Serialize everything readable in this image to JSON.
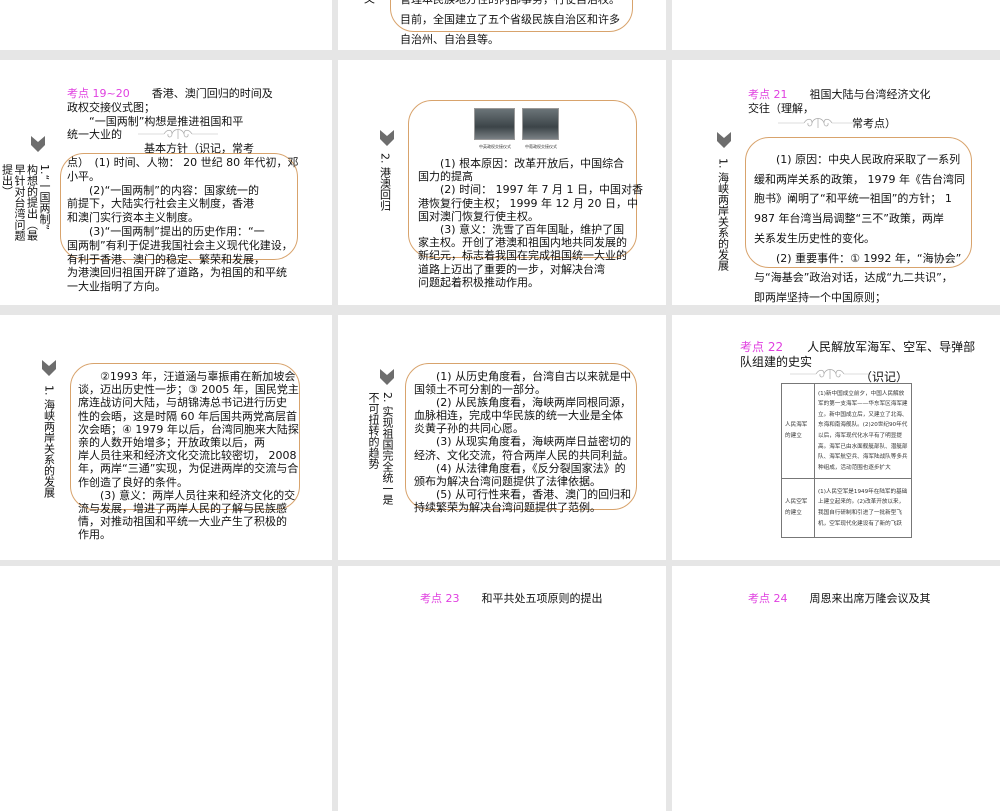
{
  "slides": [
    {
      "vertical": [
        "义"
      ],
      "body": [
        "管理本民族地方性的内部事务，行使自治权。",
        "目前，全国建立了五个省级民族自治区和许多",
        "自治州、自治县等。"
      ]
    },
    {
      "vertical": [
        "1.“一国两制”",
        "构想的提出（最",
        "早针对台湾问题",
        "提出）"
      ],
      "body": [
        {
          "tag": "考点 19~20",
          "text": "　　香港、澳门回归的时间及"
        },
        "政权交接仪式图；",
        "　　“一国两制”构想是推进祖国和平",
        "统一大业的",
        "　　　　　　　基本方针（识记，常考",
        "点）　(1) 时间、人物： 20 世纪 80 年代初，邓",
        "小平。",
        "　　(2)“一国两制”的内容：国家统一的",
        "前提下，大陆实行社会主义制度，香港",
        "和澳门实行资本主义制度。",
        "　　(3)“一国两制”提出的历史作用：“一",
        "国两制”有利于促进我国社会主义现代化建设，",
        "有利于香港、澳门的稳定、繁荣和发展，",
        "为港澳回归祖国开辟了道路，为祖国的和平统",
        "一大业指明了方向。"
      ]
    },
    {
      "vertical": [
        "2. 港澳回归"
      ],
      "captions": [
        "中英政权交接仪式",
        "中葡政权交接仪式"
      ],
      "body": [
        "　　(1) 根本原因：改革开放后，中国综合",
        "国力的提高",
        "　　(2) 时间： 1997 年 7 月 1 日，中国对香",
        "港恢复行使主权； 1999 年 12 月 20 日，中",
        "国对澳门恢复行使主权。",
        "　　(3) 意义：洗雪了百年国耻，维护了国",
        "家主权。开创了港澳和祖国内地共同发展的",
        "新纪元，标志着我国在完成祖国统一大业的",
        "道路上迈出了重要的一步，对解决台湾",
        "问题起着积极推动作用。"
      ]
    },
    {
      "vertical": [
        "1. 海峡两岸关系的发展"
      ],
      "title": [
        {
          "tag": "考点 21",
          "text": "　　祖国大陆与台湾经济文化"
        },
        "交往（理解，"
      ],
      "title_tail": "常考点）",
      "body": [
        "　　(1) 原因：中央人民政府采取了一系列",
        "缓和两岸关系的政策， 1979 年《告台湾同",
        "胞书》阐明了“和平统一祖国”的方针； 1",
        "987 年台湾当局调整“三不”政策，两岸",
        "关系发生历史性的变化。",
        "　　(2) 重要事件：① 1992 年，“海协会”",
        "与“海基会”政治对话，达成“九二共识”，",
        "即两岸坚持一个中国原则；"
      ]
    },
    {
      "vertical": [
        "1. 海峡两岸关系的发展"
      ],
      "body": [
        "　　②1993 年，汪道涵与辜振甫在新加坡会",
        "谈，迈出历史性一步；③ 2005 年，国民党主",
        "席连战访问大陆，与胡锦涛总书记进行历史",
        "性的会晤，这是时隔 60 年后国共两党高层首",
        "次会晤；④ 1979 年以后，台湾同胞来大陆探",
        "亲的人数开始增多；开放政策以后，两",
        "岸人员往来和经济文化交流比较密切， 2008",
        "年，两岸“三通”实现，为促进两岸的交流与合",
        "作创造了良好的条件。",
        "　　(3) 意义：两岸人员往来和经济文化的交",
        "流与发展，增进了两岸人民的了解与民族感",
        "情，对推动祖国和平统一大业产生了积极的",
        "作用。"
      ]
    },
    {
      "vertical": [
        "2. 实现祖国完全统一是",
        "不可扭转的趋势"
      ],
      "body": [
        "　　(1) 从历史角度看，台湾自古以来就是中",
        "国领土不可分割的一部分。",
        "　　(2) 从民族角度看，海峡两岸同根同源，",
        "血脉相连，完成中华民族的统一大业是全体",
        "炎黄子孙的共同心愿。",
        "　　(3) 从现实角度看，海峡两岸日益密切的",
        "经济、文化交流，符合两岸人民的共同利益。",
        "　　(4) 从法律角度看，《反分裂国家法》的",
        "颁布为解决台湾问题提供了法律依据。",
        "　　(5) 从可行性来看，香港、澳门的回归和",
        "持续繁荣为解决台湾问题提供了范例。"
      ]
    },
    {
      "title": [
        {
          "tag": "考点 22",
          "text": "　　人民解放军海军、空军、导弹部"
        },
        "队组建的史实"
      ],
      "title_tail": "（识记）",
      "table": [
        {
          "head": "人民海军的建立",
          "body": "(1)新中国成立前夕，中国人民解放军的第一支海军——华东军区海军建立。新中国成立后，又建立了北海、东海和南海舰队。(2)20世纪90年代以后，海军现代化水平有了明显提高。海军已由水面舰艇部队、潜艇部队、海军航空兵、海军陆战队等多兵种组成，活动范围也逐步扩大"
        },
        {
          "head": "人民空军的建立",
          "body": "(1)人民空军是1949年在陆军的基础上建立起来的。(2)改革开放以来，我国自行研制和引进了一批新型飞机，空军现代化建设有了新的飞跃"
        }
      ]
    },
    {
      "title": [
        {
          "tag": "考点 23",
          "text": "　　和平共处五项原则的提出"
        }
      ]
    },
    {
      "title": [
        {
          "tag": "考点 24",
          "text": "　　周恩来出席万隆会议及其"
        }
      ]
    }
  ]
}
